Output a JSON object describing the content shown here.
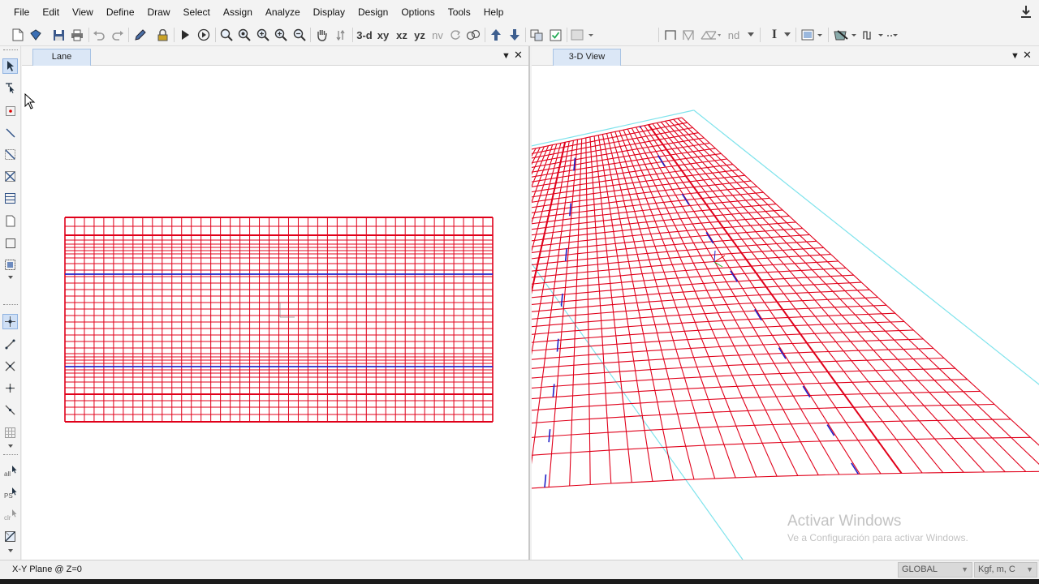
{
  "menu": {
    "items": [
      "File",
      "Edit",
      "View",
      "Define",
      "Draw",
      "Select",
      "Assign",
      "Analyze",
      "Display",
      "Design",
      "Options",
      "Tools",
      "Help"
    ]
  },
  "toolbar": {
    "view_3d": "3-d",
    "view_xy": "xy",
    "view_xz": "xz",
    "view_yz": "yz",
    "view_nv": "nv",
    "label_nd": "nd",
    "label_text": "I"
  },
  "panels": {
    "left": {
      "title": "Lane",
      "dropdown": "▼",
      "close": "✕"
    },
    "right": {
      "title": "3-D View",
      "dropdown": "▼",
      "close": "✕"
    }
  },
  "colors": {
    "mesh": "#e0001a",
    "lane": "#2020c8",
    "outline": "#7fe3ec",
    "tab_bg": "#dbe7f6"
  },
  "status": {
    "plane": "X-Y Plane @ Z=0",
    "coord_system": "GLOBAL",
    "units": "Kgf, m, C"
  },
  "watermark": {
    "title": "Activar Windows",
    "subtitle": "Ve a Configuración para activar Windows."
  },
  "left_toolbar": {
    "label_all": "all",
    "label_ps": "PS",
    "label_clr": "clr"
  }
}
